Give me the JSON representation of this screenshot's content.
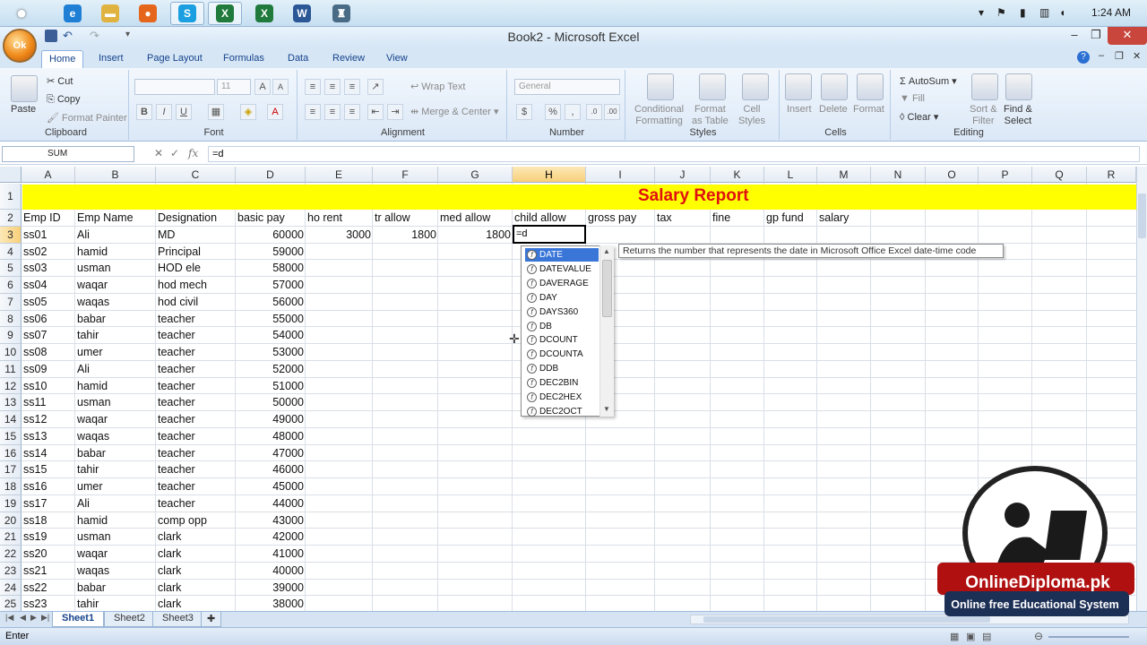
{
  "taskbar": {
    "apps": [
      {
        "name": "ie-icon",
        "glyph": "e",
        "color": "#1f7fd4"
      },
      {
        "name": "folder-icon",
        "glyph": "▬",
        "color": "#e0b341"
      },
      {
        "name": "firefox-icon",
        "glyph": "●",
        "color": "#e5661a"
      },
      {
        "name": "skype-icon",
        "glyph": "S",
        "color": "#1b9fe0"
      },
      {
        "name": "excel-icon",
        "glyph": "X",
        "color": "#1f7a3c"
      },
      {
        "name": "excel-icon-2",
        "glyph": "X",
        "color": "#1f7a3c"
      },
      {
        "name": "word-icon",
        "glyph": "W",
        "color": "#2b5797"
      },
      {
        "name": "presenter-icon",
        "glyph": "♜",
        "color": "#4a6b86"
      }
    ],
    "clock": "1:24 AM"
  },
  "window": {
    "title": "Book2 - Microsoft Excel"
  },
  "office_button_label": "Ok",
  "tabs": [
    "Home",
    "Insert",
    "Page Layout",
    "Formulas",
    "Data",
    "Review",
    "View"
  ],
  "ribbon": {
    "clipboard": {
      "paste": "Paste",
      "cut": "Cut",
      "copy": "Copy",
      "format_painter": "Format Painter",
      "label": "Clipboard"
    },
    "font": {
      "size": "11",
      "bold": "B",
      "italic": "I",
      "underline": "U",
      "label": "Font"
    },
    "alignment": {
      "wrap_text": "Wrap Text",
      "merge_center": "Merge & Center",
      "label": "Alignment"
    },
    "number": {
      "format": "General",
      "currency": "$",
      "percent": "%",
      "label": "Number"
    },
    "styles": {
      "conditional": "Conditional",
      "conditional2": "Formatting",
      "format_table": "Format",
      "format_table2": "as Table",
      "cell_styles": "Cell",
      "cell_styles2": "Styles",
      "label": "Styles"
    },
    "cells": {
      "insert": "Insert",
      "delete": "Delete",
      "format": "Format",
      "label": "Cells"
    },
    "editing": {
      "autosum": "AutoSum",
      "fill": "Fill",
      "clear": "Clear",
      "sort_filter": "Sort &",
      "sort_filter2": "Filter",
      "find_select": "Find &",
      "find_select2": "Select",
      "label": "Editing"
    }
  },
  "formula_bar": {
    "name_box": "SUM",
    "formula": "=d",
    "fx": "fx"
  },
  "columns": [
    "A",
    "B",
    "C",
    "D",
    "E",
    "F",
    "G",
    "H",
    "I",
    "J",
    "K",
    "L",
    "M",
    "N",
    "O",
    "P",
    "Q",
    "R"
  ],
  "rows": [
    "1",
    "2",
    "3",
    "4",
    "5",
    "6",
    "7",
    "8",
    "9",
    "10",
    "11",
    "12",
    "13",
    "14",
    "15",
    "16",
    "17",
    "18",
    "19",
    "20",
    "21",
    "22",
    "23",
    "24",
    "25"
  ],
  "sheet": {
    "title": "Salary Report",
    "headers": [
      "Emp ID",
      "Emp Name",
      "Designation",
      "basic pay",
      "ho rent",
      "tr allow",
      "med allow",
      "child allow",
      "gross pay",
      "tax",
      "fine",
      "gp fund",
      "salary"
    ],
    "row3_extra": {
      "ho_rent": "3000",
      "tr_allow": "1800",
      "med_allow": "1800",
      "editing": "=d"
    },
    "employees": [
      [
        "ss01",
        "Ali",
        "MD",
        "60000"
      ],
      [
        "ss02",
        "hamid",
        "Principal",
        "59000"
      ],
      [
        "ss03",
        "usman",
        "HOD ele",
        "58000"
      ],
      [
        "ss04",
        "waqar",
        "hod mech",
        "57000"
      ],
      [
        "ss05",
        "waqas",
        "hod civil",
        "56000"
      ],
      [
        "ss06",
        "babar",
        "teacher",
        "55000"
      ],
      [
        "ss07",
        "tahir",
        "teacher",
        "54000"
      ],
      [
        "ss08",
        "umer",
        "teacher",
        "53000"
      ],
      [
        "ss09",
        "Ali",
        "teacher",
        "52000"
      ],
      [
        "ss10",
        "hamid",
        "teacher",
        "51000"
      ],
      [
        "ss11",
        "usman",
        "teacher",
        "50000"
      ],
      [
        "ss12",
        "waqar",
        "teacher",
        "49000"
      ],
      [
        "ss13",
        "waqas",
        "teacher",
        "48000"
      ],
      [
        "ss14",
        "babar",
        "teacher",
        "47000"
      ],
      [
        "ss15",
        "tahir",
        "teacher",
        "46000"
      ],
      [
        "ss16",
        "umer",
        "teacher",
        "45000"
      ],
      [
        "ss17",
        "Ali",
        "teacher",
        "44000"
      ],
      [
        "ss18",
        "hamid",
        "comp opp",
        "43000"
      ],
      [
        "ss19",
        "usman",
        "clark",
        "42000"
      ],
      [
        "ss20",
        "waqar",
        "clark",
        "41000"
      ],
      [
        "ss21",
        "waqas",
        "clark",
        "40000"
      ],
      [
        "ss22",
        "babar",
        "clark",
        "39000"
      ],
      [
        "ss23",
        "tahir",
        "clark",
        "38000"
      ]
    ]
  },
  "autocomplete": {
    "items": [
      "DATE",
      "DATEVALUE",
      "DAVERAGE",
      "DAY",
      "DAYS360",
      "DB",
      "DCOUNT",
      "DCOUNTA",
      "DDB",
      "DEC2BIN",
      "DEC2HEX",
      "DEC2OCT"
    ],
    "selected": 0,
    "tooltip": "Returns the number that represents the date in Microsoft Office Excel date-time code"
  },
  "sheet_tabs": [
    "Sheet1",
    "Sheet2",
    "Sheet3"
  ],
  "status": "Enter",
  "watermark": {
    "line1": "OnlineDiploma.pk",
    "line2": "Online free Educational System"
  }
}
